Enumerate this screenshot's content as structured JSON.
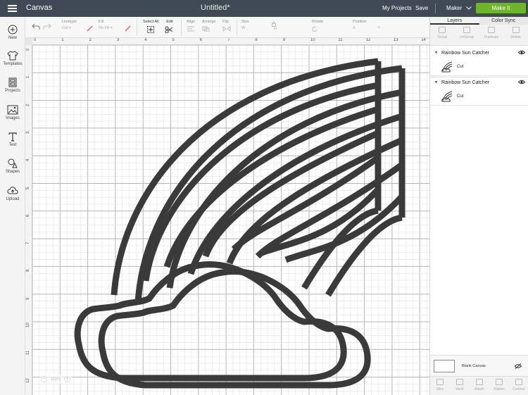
{
  "topbar": {
    "app_title": "Canvas",
    "doc_title": "Untitled*",
    "my_projects": "My Projects",
    "save": "Save",
    "machine": "Maker",
    "make_it": "Make It"
  },
  "sidebar": {
    "items": [
      {
        "label": "New",
        "icon": "plus-icon"
      },
      {
        "label": "Templates",
        "icon": "shirt-icon"
      },
      {
        "label": "Projects",
        "icon": "projects-icon"
      },
      {
        "label": "Images",
        "icon": "image-icon"
      },
      {
        "label": "Text",
        "icon": "text-icon"
      },
      {
        "label": "Shapes",
        "icon": "shapes-icon"
      },
      {
        "label": "Upload",
        "icon": "upload-icon"
      }
    ]
  },
  "toolbar": {
    "linetype_label": "Linetype",
    "linetype_value": "Cut",
    "fill_label": "Fill",
    "fill_value": "No Fill",
    "select_all": "Select All",
    "edit": "Edit",
    "align": "Align",
    "arrange": "Arrange",
    "flip": "Flip",
    "size": "Size",
    "w_label": "W",
    "h_label": "H",
    "rotate": "Rotate",
    "position": "Position",
    "x_label": "X",
    "y_label": "Y"
  },
  "rulers": {
    "top": [
      "0",
      "1",
      "2",
      "3",
      "4",
      "5",
      "6",
      "7",
      "8",
      "9",
      "10",
      "11",
      "12",
      "13",
      "14"
    ],
    "left": [
      "0",
      "1",
      "2",
      "3",
      "4",
      "5",
      "6",
      "7",
      "8",
      "9",
      "10",
      "11",
      "12"
    ]
  },
  "zoom": {
    "value": "100%",
    "minus": "−",
    "plus": "+"
  },
  "panel": {
    "tabs": [
      "Layers",
      "Color Sync"
    ],
    "actions": [
      "Group",
      "UnGroup",
      "Duplicate",
      "Delete"
    ],
    "groups": [
      {
        "name": "Rainbow Sun Catcher",
        "layer": "Cut"
      },
      {
        "name": "Rainbow Sun Catcher",
        "layer": "Cut"
      }
    ],
    "blank_canvas": "Blank Canvas",
    "bottom_actions": [
      "Slice",
      "Weld",
      "Attach",
      "Flatten",
      "Contour"
    ]
  },
  "colors": {
    "topbar": "#3f4a56",
    "make_it": "#6fb42a",
    "shape_fill": "#3a3a3a",
    "accent_pink": "#e7607a"
  }
}
